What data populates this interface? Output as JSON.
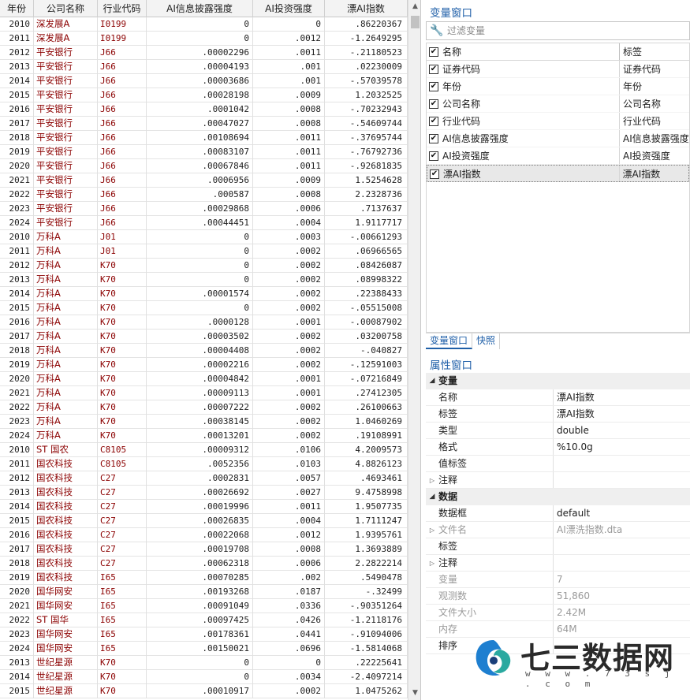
{
  "grid": {
    "columns": [
      "年份",
      "公司名称",
      "行业代码",
      "AI信息披露强度",
      "AI投资强度",
      "漂AI指数"
    ],
    "rows": [
      [
        "2010",
        "深发展A",
        "I0199",
        "0",
        "0",
        ".86220367"
      ],
      [
        "2011",
        "深发展A",
        "I0199",
        "0",
        ".0012",
        "-1.2649295"
      ],
      [
        "2012",
        "平安银行",
        "J66",
        ".00002296",
        ".0011",
        "-.21180523"
      ],
      [
        "2013",
        "平安银行",
        "J66",
        ".00004193",
        ".001",
        ".02230009"
      ],
      [
        "2014",
        "平安银行",
        "J66",
        ".00003686",
        ".001",
        "-.57039578"
      ],
      [
        "2015",
        "平安银行",
        "J66",
        ".00028198",
        ".0009",
        "1.2032525"
      ],
      [
        "2016",
        "平安银行",
        "J66",
        ".0001042",
        ".0008",
        "-.70232943"
      ],
      [
        "2017",
        "平安银行",
        "J66",
        ".00047027",
        ".0008",
        "-.54609744"
      ],
      [
        "2018",
        "平安银行",
        "J66",
        ".00108694",
        ".0011",
        "-.37695744"
      ],
      [
        "2019",
        "平安银行",
        "J66",
        ".00083107",
        ".0011",
        "-.76792736"
      ],
      [
        "2020",
        "平安银行",
        "J66",
        ".00067846",
        ".0011",
        "-.92681835"
      ],
      [
        "2021",
        "平安银行",
        "J66",
        ".0006956",
        ".0009",
        "1.5254628"
      ],
      [
        "2022",
        "平安银行",
        "J66",
        ".000587",
        ".0008",
        "2.2328736"
      ],
      [
        "2023",
        "平安银行",
        "J66",
        ".00029868",
        ".0006",
        ".7137637"
      ],
      [
        "2024",
        "平安银行",
        "J66",
        ".00044451",
        ".0004",
        "1.9117717"
      ],
      [
        "2010",
        "万科A",
        "J01",
        "0",
        ".0003",
        "-.00661293"
      ],
      [
        "2011",
        "万科A",
        "J01",
        "0",
        ".0002",
        ".06966565"
      ],
      [
        "2012",
        "万科A",
        "K70",
        "0",
        ".0002",
        ".08426087"
      ],
      [
        "2013",
        "万科A",
        "K70",
        "0",
        ".0002",
        ".08998322"
      ],
      [
        "2014",
        "万科A",
        "K70",
        ".00001574",
        ".0002",
        ".22388433"
      ],
      [
        "2015",
        "万科A",
        "K70",
        "0",
        ".0002",
        "-.05515008"
      ],
      [
        "2016",
        "万科A",
        "K70",
        ".0000128",
        ".0001",
        "-.00087902"
      ],
      [
        "2017",
        "万科A",
        "K70",
        ".00003502",
        ".0002",
        ".03200758"
      ],
      [
        "2018",
        "万科A",
        "K70",
        ".00004408",
        ".0002",
        "-.040827"
      ],
      [
        "2019",
        "万科A",
        "K70",
        ".00002216",
        ".0002",
        "-.12591003"
      ],
      [
        "2020",
        "万科A",
        "K70",
        ".00004842",
        ".0001",
        "-.07216849"
      ],
      [
        "2021",
        "万科A",
        "K70",
        ".00009113",
        ".0001",
        ".27412305"
      ],
      [
        "2022",
        "万科A",
        "K70",
        ".00007222",
        ".0002",
        ".26100663"
      ],
      [
        "2023",
        "万科A",
        "K70",
        ".00038145",
        ".0002",
        "1.0460269"
      ],
      [
        "2024",
        "万科A",
        "K70",
        ".00013201",
        ".0002",
        ".19108991"
      ],
      [
        "2010",
        "ST 国农",
        "C8105",
        ".00009312",
        ".0106",
        "4.2009573"
      ],
      [
        "2011",
        "国农科技",
        "C8105",
        ".0052356",
        ".0103",
        "4.8826123"
      ],
      [
        "2012",
        "国农科技",
        "C27",
        ".0002831",
        ".0057",
        ".4693461"
      ],
      [
        "2013",
        "国农科技",
        "C27",
        ".00026692",
        ".0027",
        "9.4758998"
      ],
      [
        "2014",
        "国农科技",
        "C27",
        ".00019996",
        ".0011",
        "1.9507735"
      ],
      [
        "2015",
        "国农科技",
        "C27",
        ".00026835",
        ".0004",
        "1.7111247"
      ],
      [
        "2016",
        "国农科技",
        "C27",
        ".00022068",
        ".0012",
        "1.9395761"
      ],
      [
        "2017",
        "国农科技",
        "C27",
        ".00019708",
        ".0008",
        "1.3693889"
      ],
      [
        "2018",
        "国农科技",
        "C27",
        ".00062318",
        ".0006",
        "2.2822214"
      ],
      [
        "2019",
        "国农科技",
        "I65",
        ".00070285",
        ".002",
        ".5490478"
      ],
      [
        "2020",
        "国华网安",
        "I65",
        ".00193268",
        ".0187",
        "-.32499"
      ],
      [
        "2021",
        "国华网安",
        "I65",
        ".00091049",
        ".0336",
        "-.90351264"
      ],
      [
        "2022",
        "ST 国华",
        "I65",
        ".00097425",
        ".0426",
        "-1.2118176"
      ],
      [
        "2023",
        "国华网安",
        "I65",
        ".00178361",
        ".0441",
        "-.91094006"
      ],
      [
        "2024",
        "国华网安",
        "I65",
        ".00150021",
        ".0696",
        "-1.5814068"
      ],
      [
        "2013",
        "世纪星源",
        "K70",
        "0",
        "0",
        ".22225641"
      ],
      [
        "2014",
        "世纪星源",
        "K70",
        "0",
        ".0034",
        "-2.4097214"
      ],
      [
        "2015",
        "世纪星源",
        "K70",
        ".00010917",
        ".0002",
        "1.0475262"
      ]
    ]
  },
  "variables_window": {
    "title": "变量窗口",
    "filter_placeholder": "过滤变量",
    "header_name": "名称",
    "header_label": "标签",
    "items": [
      {
        "name": "证券代码",
        "label": "证券代码"
      },
      {
        "name": "年份",
        "label": "年份"
      },
      {
        "name": "公司名称",
        "label": "公司名称"
      },
      {
        "name": "行业代码",
        "label": "行业代码"
      },
      {
        "name": "AI信息披露强度",
        "label": "AI信息披露强度"
      },
      {
        "name": "AI投资强度",
        "label": "AI投资强度"
      },
      {
        "name": "漂AI指数",
        "label": "漂AI指数"
      }
    ]
  },
  "tabs": [
    "变量窗口",
    "快照"
  ],
  "properties_window": {
    "title": "属性窗口",
    "sections": [
      {
        "title": "变量",
        "rows": [
          {
            "key": "名称",
            "value": "漂AI指数",
            "expandable": false,
            "dim": false
          },
          {
            "key": "标签",
            "value": "漂AI指数",
            "expandable": false,
            "dim": false
          },
          {
            "key": "类型",
            "value": "double",
            "expandable": false,
            "dim": false
          },
          {
            "key": "格式",
            "value": "%10.0g",
            "expandable": false,
            "dim": false
          },
          {
            "key": "值标签",
            "value": "",
            "expandable": false,
            "dim": false
          },
          {
            "key": "注释",
            "value": "",
            "expandable": true,
            "dim": false
          }
        ]
      },
      {
        "title": "数据",
        "rows": [
          {
            "key": "数据框",
            "value": "default",
            "expandable": false,
            "dim": false
          },
          {
            "key": "文件名",
            "value": "AI漂洗指数.dta",
            "expandable": true,
            "dim": true
          },
          {
            "key": "标签",
            "value": "",
            "expandable": false,
            "dim": false
          },
          {
            "key": "注释",
            "value": "",
            "expandable": true,
            "dim": false
          },
          {
            "key": "变量",
            "value": "7",
            "expandable": false,
            "dim": true
          },
          {
            "key": "观测数",
            "value": "51,860",
            "expandable": false,
            "dim": true
          },
          {
            "key": "文件大小",
            "value": "2.42M",
            "expandable": false,
            "dim": true
          },
          {
            "key": "内存",
            "value": "64M",
            "expandable": false,
            "dim": true
          },
          {
            "key": "排序",
            "value": "",
            "expandable": false,
            "dim": false
          }
        ]
      }
    ]
  },
  "watermark": {
    "brand": "七三数据网",
    "url": "w w w . 7 3 s j . c o m"
  },
  "icons": {
    "filter": "wrench-icon",
    "scroll_up": "triangle-up-icon",
    "scroll_down": "triangle-down-icon",
    "section_toggle": "triangle-down-icon",
    "row_expand": "triangle-right-icon"
  },
  "colors": {
    "panel_title": "#1f5fa8",
    "string_cell": "#8b0000"
  }
}
